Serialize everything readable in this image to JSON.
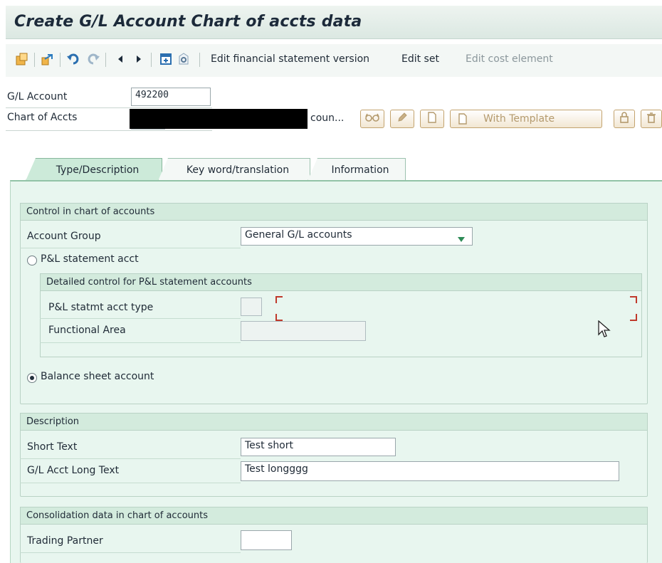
{
  "window": {
    "title": "Create G/L Account Chart of accts data"
  },
  "toolbar": {
    "icons": [
      "display-change-icon",
      "other-account-icon",
      "undo-icon",
      "redo-icon",
      "previous-icon",
      "next-icon",
      "document-icon",
      "where-used-icon"
    ],
    "edit_fsv_label": "Edit financial statement version",
    "edit_set_label": "Edit set",
    "edit_cost_element_label": "Edit cost element"
  },
  "header": {
    "gl_account_label": "G/L Account",
    "gl_account_value": "492200",
    "chart_of_accts_label": "Chart of Accts",
    "chart_of_accts_desc": "coun...",
    "with_template_label": "With Template"
  },
  "tabs": [
    {
      "label": "Type/Description",
      "active": true
    },
    {
      "label": "Key word/translation",
      "active": false
    },
    {
      "label": "Information",
      "active": false
    }
  ],
  "control": {
    "title": "Control in chart of accounts",
    "account_group_label": "Account Group",
    "account_group_value": "General G/L accounts",
    "pl_label": "P&L statement acct",
    "pl_selected": false,
    "detailed_title": "Detailed control for P&L statement accounts",
    "pl_type_label": "P&L statmt acct type",
    "pl_type_value": "",
    "functional_area_label": "Functional Area",
    "functional_area_value": "",
    "bs_label": "Balance sheet account",
    "bs_selected": true
  },
  "description": {
    "title": "Description",
    "short_text_label": "Short Text",
    "short_text_value": "Test short",
    "long_text_label": "G/L Acct Long Text",
    "long_text_value": "Test longggg"
  },
  "consolidation": {
    "title": "Consolidation data in chart of accounts",
    "trading_partner_label": "Trading Partner",
    "trading_partner_value": ""
  },
  "colors": {
    "content_bg": "#e8f6ef",
    "group_header_bg": "#d3ebdd",
    "active_tab": "#ccead9",
    "dropdown_arrow": "#2e8b57"
  }
}
